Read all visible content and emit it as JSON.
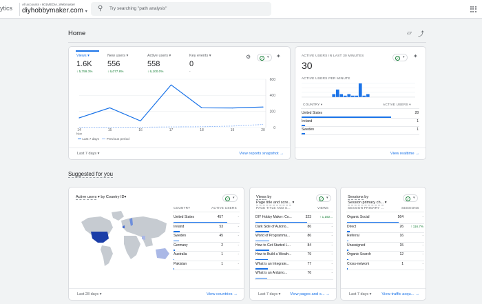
{
  "header": {
    "app_name": "ytics",
    "breadcrumb": "All accounts › 601MEDIA_Webmaster",
    "property": "diyhobbymaker.com",
    "search_placeholder": "Try searching \"path analysis\""
  },
  "page": {
    "title": "Home",
    "suggested_title": "Suggested for you"
  },
  "overview": {
    "metrics": [
      {
        "label": "Views",
        "value": "1.6K",
        "change": "↑ 5,759.3%"
      },
      {
        "label": "New users",
        "value": "556",
        "change": "↑ 6,077.8%"
      },
      {
        "label": "Active users",
        "value": "558",
        "change": "↑ 6,100.0%"
      },
      {
        "label": "Key events",
        "value": "0",
        "change": "-"
      }
    ],
    "legend_current": "Last 7 days",
    "legend_previous": "Previous period",
    "date_range": "Last 7 days",
    "link": "View reports snapshot"
  },
  "chart_data": {
    "type": "line",
    "x": [
      "14 Nov",
      "15",
      "16",
      "17",
      "18",
      "19",
      "20"
    ],
    "x_tick_main": [
      "14",
      "15",
      "16",
      "17",
      "18",
      "19",
      "20"
    ],
    "x_tick_sub": "Nov",
    "series": [
      {
        "name": "Last 7 days",
        "values": [
          120,
          245,
          82,
          530,
          245,
          243,
          255
        ]
      },
      {
        "name": "Previous period",
        "values": [
          2,
          3,
          4,
          8,
          10,
          18,
          38
        ]
      }
    ],
    "yticks": [
      "600",
      "400",
      "200",
      "0"
    ],
    "ylim": [
      0,
      600
    ],
    "colors": {
      "current": "#1a73e8",
      "previous": "#8ab4f8"
    }
  },
  "realtime": {
    "title": "ACTIVE USERS IN LAST 30 MINUTES",
    "value": "30",
    "per_minute_label": "ACTIVE USERS PER MINUTE",
    "per_minute": [
      0,
      0,
      0,
      0,
      0,
      0,
      0,
      0,
      2,
      5,
      2,
      1,
      2,
      1,
      1,
      9,
      1,
      2,
      0,
      0,
      0,
      0,
      0,
      0,
      0,
      0,
      0,
      0,
      0,
      0
    ],
    "col1": "COUNTRY",
    "col2": "ACTIVE USERS",
    "rows": [
      {
        "name": "United States",
        "value": "28",
        "share": 1.0
      },
      {
        "name": "Ireland",
        "value": "1",
        "share": 0.04
      },
      {
        "name": "Sweden",
        "value": "1",
        "share": 0.04
      }
    ],
    "link": "View realtime"
  },
  "country_card": {
    "title_metric": "Active users",
    "title_by": "by Country ID",
    "col1": "COUNTRY",
    "col2": "ACTIVE USERS",
    "rows": [
      {
        "name": "United States",
        "value": "457",
        "change": "-",
        "share": 1.0
      },
      {
        "name": "Ireland",
        "value": "53",
        "change": "-",
        "share": 0.12
      },
      {
        "name": "Sweden",
        "value": "45",
        "change": "-",
        "share": 0.1
      },
      {
        "name": "Germany",
        "value": "2",
        "change": "-",
        "share": 0.02
      },
      {
        "name": "Australia",
        "value": "1",
        "change": "-",
        "share": 0.01
      },
      {
        "name": "Pakistan",
        "value": "1",
        "change": "-",
        "share": 0.01
      }
    ],
    "date_range": "Last 28 days",
    "link": "View countries"
  },
  "pages_card": {
    "title_metric": "Views",
    "title_by": "by",
    "title_dim": "Page title and scre...",
    "col1": "PAGE TITLE AND S...",
    "col2": "VIEWS",
    "rows": [
      {
        "name": "DIY Hobby Maker: Co...",
        "value": "323",
        "change": "↑ 1,192...",
        "share": 1.0
      },
      {
        "name": "Dark Side of Autono...",
        "value": "86",
        "change": "-",
        "share": 0.27
      },
      {
        "name": "World of Programma...",
        "value": "86",
        "change": "-",
        "share": 0.27
      },
      {
        "name": "How to Get Started L...",
        "value": "84",
        "change": "-",
        "share": 0.26
      },
      {
        "name": "How to Build a Weath...",
        "value": "79",
        "change": "-",
        "share": 0.24
      },
      {
        "name": "What is an Integrate...",
        "value": "77",
        "change": "-",
        "share": 0.24
      },
      {
        "name": "What is an Arduino...",
        "value": "76",
        "change": "-",
        "share": 0.23
      }
    ],
    "date_range": "Last 7 days",
    "link": "View pages and s..."
  },
  "sessions_card": {
    "title_metric": "Sessions",
    "title_by": "by",
    "title_dim": "Session primary ch...",
    "col1": "SESSION PRIMARY ...",
    "col2": "SESSIONS",
    "rows": [
      {
        "name": "Organic Social",
        "value": "564",
        "change": "-",
        "share": 1.0
      },
      {
        "name": "Direct",
        "value": "26",
        "change": "↑ 116.7%",
        "share": 0.05
      },
      {
        "name": "Referral",
        "value": "16",
        "change": "-",
        "share": 0.03
      },
      {
        "name": "Unassigned",
        "value": "15",
        "change": "-",
        "share": 0.03
      },
      {
        "name": "Organic Search",
        "value": "12",
        "change": "-",
        "share": 0.02
      },
      {
        "name": "Cross-network",
        "value": "1",
        "change": "-",
        "share": 0.0
      }
    ],
    "date_range": "Last 7 days",
    "link": "View traffic acqu..."
  }
}
